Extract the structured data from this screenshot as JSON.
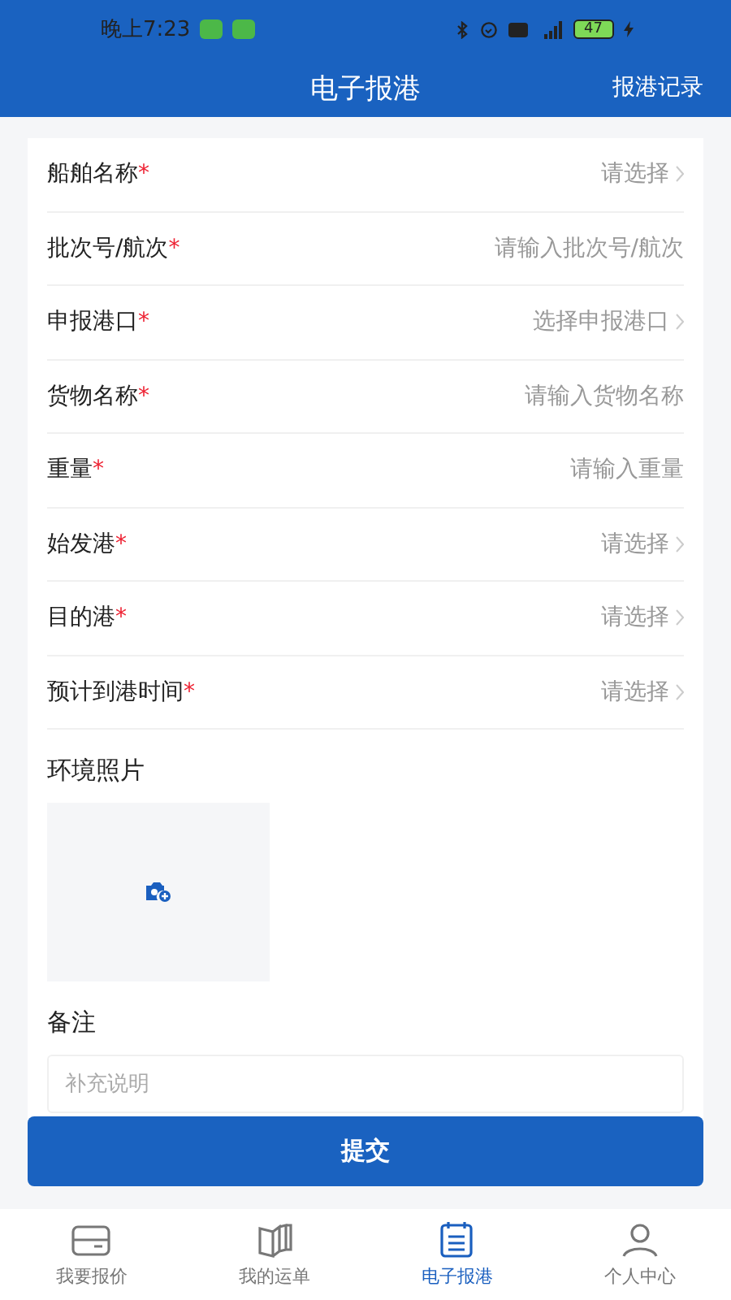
{
  "status_bar": {
    "time": "晚上7:23",
    "battery": "47"
  },
  "header": {
    "title": "电子报港",
    "action": "报港记录"
  },
  "fields": [
    {
      "label": "船舶名称",
      "mark": "*",
      "kind": "select",
      "placeholder": "请选择"
    },
    {
      "label": "批次号/航次",
      "mark": "*",
      "kind": "input",
      "placeholder": "请输入批次号/航次"
    },
    {
      "label": "申报港口",
      "mark": "*",
      "kind": "select",
      "placeholder": "选择申报港口"
    },
    {
      "label": "货物名称",
      "mark": "*",
      "kind": "input",
      "placeholder": "请输入货物名称"
    },
    {
      "label": "重量",
      "mark": "*",
      "kind": "input",
      "placeholder": "请输入重量"
    },
    {
      "label": "始发港",
      "mark": "*",
      "kind": "select",
      "placeholder": "请选择"
    },
    {
      "label": "目的港",
      "mark": "*",
      "kind": "select",
      "placeholder": "请选择"
    },
    {
      "label": "预计到港时间",
      "mark": "*",
      "kind": "select",
      "placeholder": "请选择"
    }
  ],
  "photo": {
    "label": "环境照片"
  },
  "remark": {
    "label": "备注",
    "placeholder": "补充说明"
  },
  "submit": "提交",
  "tabs": [
    {
      "label": "我要报价",
      "kind": "quote",
      "selected": false
    },
    {
      "label": "我的运单",
      "kind": "orders",
      "selected": false
    },
    {
      "label": "电子报港",
      "kind": "report",
      "selected": true
    },
    {
      "label": "个人中心",
      "kind": "profile",
      "selected": false
    }
  ]
}
